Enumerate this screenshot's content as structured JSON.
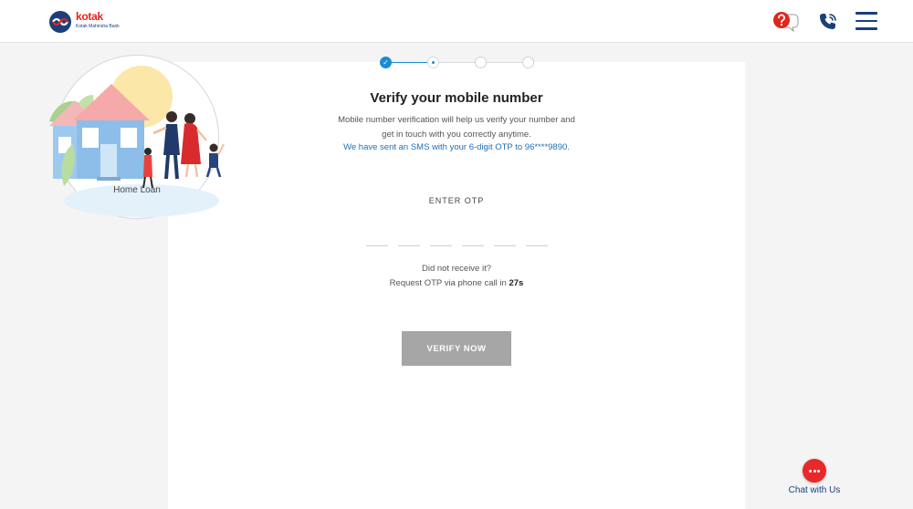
{
  "header": {
    "brand_name": "kotak",
    "brand_sub": "Kotak Mahindra Bank",
    "help_icon": "help-chat-icon",
    "phone_icon": "phone-icon",
    "menu_icon": "hamburger-menu-icon"
  },
  "stepper": {
    "total_steps": 4,
    "completed_steps": 1,
    "current_step": 2
  },
  "hero": {
    "label": "Home Loan"
  },
  "verify": {
    "title": "Verify your mobile number",
    "description_line1": "Mobile number verification will help us verify your number and",
    "description_line2": "get in touch with you correctly anytime.",
    "sms_notice": "We have sent an SMS with your 6-digit OTP to 96****9890.",
    "otp_label": "ENTER OTP",
    "otp_values": [
      "",
      "",
      "",
      "",
      "",
      ""
    ],
    "resend_question": "Did not receive it?",
    "resend_text": "Request OTP via phone call in",
    "resend_timer": "27s",
    "button_label": "VERIFY NOW"
  },
  "chat": {
    "label": "Chat with Us",
    "icon": "chat-icon"
  },
  "colors": {
    "brand_red": "#e1251b",
    "brand_navy": "#1b3f7a",
    "step_blue": "#1a8ed3",
    "link_blue": "#1f6fb4",
    "button_disabled": "#a6a6a6",
    "chat_red": "#e8282a"
  }
}
